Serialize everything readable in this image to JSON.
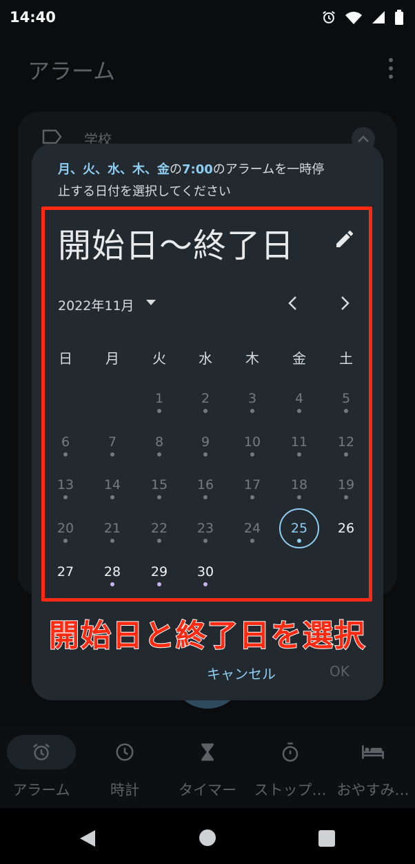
{
  "status": {
    "time": "14:40",
    "icons": [
      "alarm-icon",
      "wifi-icon",
      "signal-icon",
      "battery-icon"
    ]
  },
  "app": {
    "title": "アラーム"
  },
  "background_card": {
    "label": "学校"
  },
  "dialog": {
    "message": {
      "days": "月、火、水、木、金",
      "connector1": "の",
      "time": "7:00",
      "rest": "のアラームを一時停止する日付を選択してください"
    },
    "range_title": "開始日〜終了日",
    "month_label": "2022年11月",
    "weekdays": [
      "日",
      "月",
      "火",
      "水",
      "木",
      "金",
      "土"
    ],
    "days": [
      {
        "n": "1",
        "state": "past"
      },
      {
        "n": "2",
        "state": "past"
      },
      {
        "n": "3",
        "state": "past"
      },
      {
        "n": "4",
        "state": "past"
      },
      {
        "n": "5",
        "state": "past"
      },
      {
        "n": "6",
        "state": "past"
      },
      {
        "n": "7",
        "state": "past"
      },
      {
        "n": "8",
        "state": "past"
      },
      {
        "n": "9",
        "state": "past"
      },
      {
        "n": "10",
        "state": "past"
      },
      {
        "n": "11",
        "state": "past"
      },
      {
        "n": "12",
        "state": "past"
      },
      {
        "n": "13",
        "state": "past"
      },
      {
        "n": "14",
        "state": "past"
      },
      {
        "n": "15",
        "state": "past"
      },
      {
        "n": "16",
        "state": "past"
      },
      {
        "n": "17",
        "state": "past"
      },
      {
        "n": "18",
        "state": "past"
      },
      {
        "n": "19",
        "state": "past"
      },
      {
        "n": "20",
        "state": "past"
      },
      {
        "n": "21",
        "state": "past"
      },
      {
        "n": "22",
        "state": "past"
      },
      {
        "n": "23",
        "state": "past"
      },
      {
        "n": "24",
        "state": "past"
      },
      {
        "n": "25",
        "state": "today"
      },
      {
        "n": "26",
        "state": "active"
      },
      {
        "n": "27",
        "state": "active"
      },
      {
        "n": "28",
        "state": "active"
      },
      {
        "n": "29",
        "state": "active"
      },
      {
        "n": "30",
        "state": "active"
      }
    ],
    "cancel_label": "キャンセル",
    "ok_label": "OK"
  },
  "annotation": {
    "caption": "開始日と終了日を選択"
  },
  "colors": {
    "accent": "#8fcdf2",
    "highlight": "#ff2a12",
    "dot_active": "#c7b3f0"
  },
  "bottom_nav": {
    "items": [
      {
        "label": "アラーム",
        "icon": "alarm-clock-icon",
        "selected": true
      },
      {
        "label": "時計",
        "icon": "clock-icon",
        "selected": false
      },
      {
        "label": "タイマー",
        "icon": "hourglass-icon",
        "selected": false
      },
      {
        "label": "ストップ…",
        "icon": "stopwatch-icon",
        "selected": false
      },
      {
        "label": "おやすみ…",
        "icon": "bed-icon",
        "selected": false
      }
    ]
  }
}
